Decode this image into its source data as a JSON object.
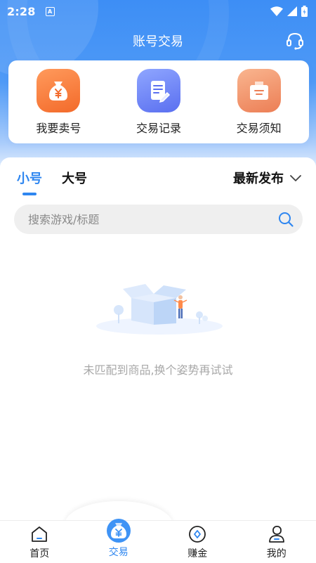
{
  "status_bar": {
    "time": "2:28",
    "badge": "A"
  },
  "header": {
    "title": "账号交易",
    "service_icon": "headset-icon"
  },
  "quick_actions": [
    {
      "label": "我要卖号",
      "icon": "money-bag-icon",
      "color": "#f36a2a"
    },
    {
      "label": "交易记录",
      "icon": "document-edit-icon",
      "color": "#5a6ff0"
    },
    {
      "label": "交易须知",
      "icon": "notice-box-icon",
      "color": "#ec7e55"
    }
  ],
  "tabs": [
    {
      "label": "小号",
      "active": true
    },
    {
      "label": "大号",
      "active": false
    }
  ],
  "sort": {
    "selected": "最新发布"
  },
  "search": {
    "placeholder": "搜索游戏/标题",
    "value": ""
  },
  "empty_state": {
    "text": "未匹配到商品,换个姿势再试试"
  },
  "bottom_nav": [
    {
      "label": "首页",
      "icon": "home-icon",
      "active": false
    },
    {
      "label": "交易",
      "icon": "yen-bag-icon",
      "active": true
    },
    {
      "label": "赚金",
      "icon": "coin-icon",
      "active": false
    },
    {
      "label": "我的",
      "icon": "user-icon",
      "active": false
    }
  ],
  "colors": {
    "accent": "#2e86f0",
    "header_bg": "#3d8ef5"
  }
}
